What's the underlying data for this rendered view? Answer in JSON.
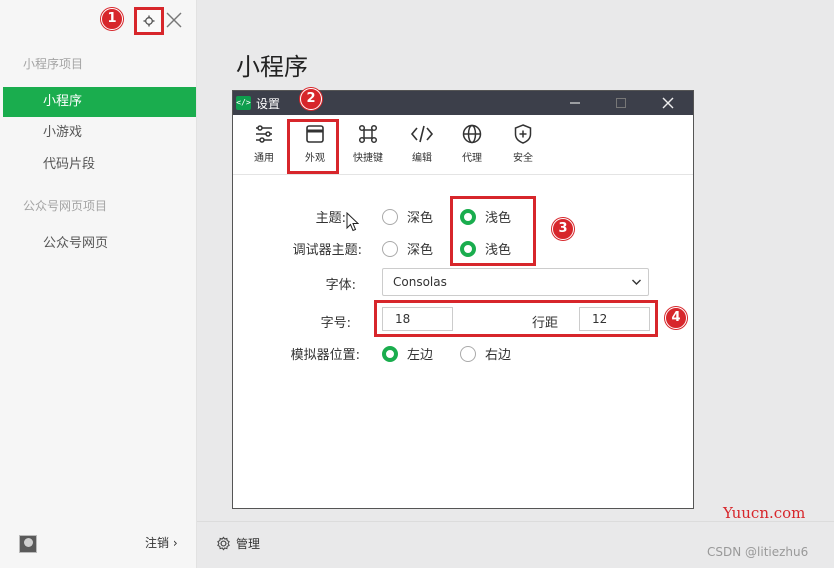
{
  "sidebar": {
    "sections": [
      {
        "title": "小程序项目",
        "items": [
          "小程序",
          "小游戏",
          "代码片段"
        ]
      },
      {
        "title": "公众号网页项目",
        "items": [
          "公众号网页"
        ]
      }
    ],
    "active_item": "小程序",
    "logout_label": "注销 ›"
  },
  "main": {
    "title": "小程序",
    "manage_label": "管理"
  },
  "dialog": {
    "title": "设置",
    "icon_text": "</>",
    "tabs": [
      "通用",
      "外观",
      "快捷键",
      "编辑",
      "代理",
      "安全"
    ],
    "selected_tab": "外观",
    "settings": {
      "theme": {
        "label": "主题:",
        "options": [
          "深色",
          "浅色"
        ],
        "selected": "浅色"
      },
      "debugger_theme": {
        "label": "调试器主题:",
        "options": [
          "深色",
          "浅色"
        ],
        "selected": "浅色"
      },
      "font": {
        "label": "字体:",
        "value": "Consolas"
      },
      "font_size": {
        "label": "字号:",
        "value": "18"
      },
      "line_height": {
        "label": "行距",
        "value": "12"
      },
      "simulator_position": {
        "label": "模拟器位置:",
        "options": [
          "左边",
          "右边"
        ],
        "selected": "左边"
      }
    }
  },
  "annotations": {
    "badges": [
      "1",
      "2",
      "3",
      "4"
    ],
    "color": "#d7262b"
  },
  "watermarks": {
    "site": "Yuucn.com",
    "credit": "CSDN @litiezhu6"
  },
  "colors": {
    "accent": "#1aad4e",
    "titlebar": "#3c3f4a"
  }
}
